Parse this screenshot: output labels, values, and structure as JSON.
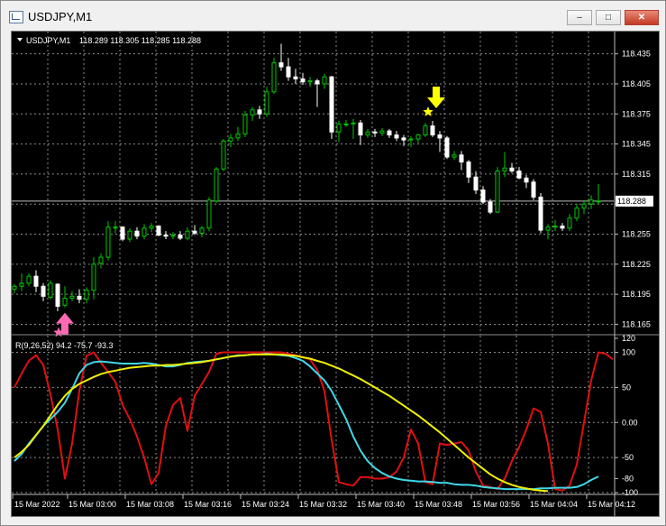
{
  "window": {
    "title": "USDJPY,M1",
    "min_glyph": "–",
    "max_glyph": "□",
    "close_glyph": "✕"
  },
  "chart_header": {
    "symbol": "USDJPY,M1",
    "ohlc": "118.289 118.305 118.285 118.288"
  },
  "price_axis": {
    "ticks": [
      "118.435",
      "118.405",
      "118.375",
      "118.345",
      "118.315",
      "118.285",
      "118.255",
      "118.225",
      "118.195",
      "118.165"
    ],
    "current_price": "118.288"
  },
  "indicator": {
    "label": "R(9,26,52) 94.2 -75.7 -93.3",
    "ticks": [
      "120",
      "100",
      "50",
      "0.00",
      "-50",
      "-80",
      "-100"
    ]
  },
  "time_axis": {
    "ticks": [
      "15 Mar 2022",
      "15 Mar 03:00",
      "15 Mar 03:08",
      "15 Mar 03:16",
      "15 Mar 03:24",
      "15 Mar 03:32",
      "15 Mar 03:40",
      "15 Mar 03:48",
      "15 Mar 03:56",
      "15 Mar 04:04",
      "15 Mar 04:12"
    ]
  },
  "colors": {
    "bull": "#00c800",
    "bear": "#ffffff",
    "grid": "#8c8c8c",
    "red": "#e01010",
    "cyan": "#40d8e8",
    "yellow": "#f0f000",
    "buy_arrow": "#ff69b4",
    "sell_arrow": "#ffff00"
  },
  "chart_data": [
    {
      "type": "candlestick",
      "ylim": [
        118.16,
        118.45
      ],
      "candles": [
        [
          118.2,
          118.205,
          118.196,
          118.203
        ],
        [
          118.203,
          118.216,
          118.198,
          118.206
        ],
        [
          118.206,
          118.216,
          118.203,
          118.213
        ],
        [
          118.213,
          118.219,
          118.197,
          118.203
        ],
        [
          118.203,
          118.206,
          118.188,
          118.193
        ],
        [
          118.192,
          118.209,
          118.19,
          118.206
        ],
        [
          118.205,
          118.206,
          118.178,
          118.183
        ],
        [
          118.184,
          118.203,
          118.182,
          118.191
        ],
        [
          118.191,
          118.198,
          118.188,
          118.193
        ],
        [
          118.193,
          118.2,
          118.186,
          118.19
        ],
        [
          118.19,
          118.202,
          118.186,
          118.199
        ],
        [
          118.199,
          118.232,
          118.19,
          118.225
        ],
        [
          118.226,
          118.236,
          118.221,
          118.232
        ],
        [
          118.232,
          118.268,
          118.229,
          118.262
        ],
        [
          118.262,
          118.268,
          118.256,
          118.262
        ],
        [
          118.262,
          118.263,
          118.248,
          118.25
        ],
        [
          118.25,
          118.261,
          118.247,
          118.258
        ],
        [
          118.258,
          118.262,
          118.25,
          118.253
        ],
        [
          118.253,
          118.265,
          118.25,
          118.261
        ],
        [
          118.261,
          118.266,
          118.257,
          118.263
        ],
        [
          118.263,
          118.264,
          118.253,
          118.254
        ],
        [
          118.254,
          118.258,
          118.25,
          118.253
        ],
        [
          118.253,
          118.257,
          118.25,
          118.254
        ],
        [
          118.254,
          118.258,
          118.249,
          118.251
        ],
        [
          118.251,
          118.262,
          118.249,
          118.258
        ],
        [
          118.258,
          118.264,
          118.254,
          118.256
        ],
        [
          118.256,
          118.263,
          118.252,
          118.261
        ],
        [
          118.261,
          118.292,
          118.258,
          118.289
        ],
        [
          118.288,
          118.322,
          118.286,
          118.32
        ],
        [
          118.32,
          118.35,
          118.318,
          118.348
        ],
        [
          118.348,
          118.355,
          118.342,
          118.351
        ],
        [
          118.351,
          118.362,
          118.348,
          118.355
        ],
        [
          118.355,
          118.378,
          118.352,
          118.374
        ],
        [
          118.374,
          118.382,
          118.368,
          118.379
        ],
        [
          118.379,
          118.383,
          118.37,
          118.375
        ],
        [
          118.375,
          118.402,
          118.372,
          118.397
        ],
        [
          118.397,
          118.431,
          118.395,
          118.426
        ],
        [
          118.426,
          118.445,
          118.418,
          118.422
        ],
        [
          118.422,
          118.431,
          118.408,
          118.412
        ],
        [
          118.412,
          118.42,
          118.405,
          118.41
        ],
        [
          118.41,
          118.416,
          118.404,
          118.407
        ],
        [
          118.407,
          118.412,
          118.402,
          118.408
        ],
        [
          118.408,
          118.41,
          118.382,
          118.405
        ],
        [
          118.405,
          118.415,
          118.4,
          118.412
        ],
        [
          118.412,
          118.413,
          118.35,
          118.357
        ],
        [
          118.357,
          118.368,
          118.347,
          118.365
        ],
        [
          118.364,
          118.369,
          118.362,
          118.365
        ],
        [
          118.365,
          118.37,
          118.35,
          118.366
        ],
        [
          118.366,
          118.369,
          118.344,
          118.354
        ],
        [
          118.354,
          118.36,
          118.351,
          118.357
        ],
        [
          118.357,
          118.36,
          118.352,
          118.356
        ],
        [
          118.356,
          118.361,
          118.353,
          118.358
        ],
        [
          118.358,
          118.36,
          118.351,
          118.354
        ],
        [
          118.354,
          118.358,
          118.348,
          118.351
        ],
        [
          118.351,
          118.354,
          118.343,
          118.349
        ],
        [
          118.349,
          118.353,
          118.342,
          118.35
        ],
        [
          118.35,
          118.355,
          118.346,
          118.354
        ],
        [
          118.354,
          118.366,
          118.352,
          118.363
        ],
        [
          118.363,
          118.368,
          118.352,
          118.354
        ],
        [
          118.354,
          118.358,
          118.337,
          118.351
        ],
        [
          118.351,
          118.353,
          118.33,
          118.332
        ],
        [
          118.332,
          118.338,
          118.329,
          118.334
        ],
        [
          118.334,
          118.338,
          118.319,
          118.327
        ],
        [
          118.327,
          118.329,
          118.306,
          118.312
        ],
        [
          118.312,
          118.318,
          118.295,
          118.299
        ],
        [
          118.299,
          118.303,
          118.285,
          118.287
        ],
        [
          118.287,
          118.29,
          118.275,
          118.277
        ],
        [
          118.277,
          118.322,
          118.276,
          118.318
        ],
        [
          118.318,
          118.337,
          118.312,
          118.321
        ],
        [
          118.321,
          118.326,
          118.316,
          118.318
        ],
        [
          118.318,
          118.322,
          118.31,
          118.311
        ],
        [
          118.311,
          118.314,
          118.301,
          118.307
        ],
        [
          118.307,
          118.31,
          118.289,
          118.292
        ],
        [
          118.292,
          118.296,
          118.256,
          118.259
        ],
        [
          118.259,
          118.265,
          118.25,
          118.262
        ],
        [
          118.262,
          118.269,
          118.258,
          118.263
        ],
        [
          118.263,
          118.266,
          118.258,
          118.261
        ],
        [
          118.261,
          118.275,
          118.258,
          118.271
        ],
        [
          118.271,
          118.285,
          118.268,
          118.281
        ],
        [
          118.281,
          118.289,
          118.275,
          118.285
        ],
        [
          118.285,
          118.294,
          118.28,
          118.289
        ],
        [
          118.288,
          118.305,
          118.285,
          118.288
        ]
      ],
      "signals": [
        {
          "kind": "buy",
          "candle": 7
        },
        {
          "kind": "sell",
          "candle": 58
        }
      ]
    },
    {
      "type": "line",
      "ylim": [
        -100,
        120
      ],
      "series": [
        {
          "color": "#e01010",
          "values": [
            50,
            70,
            88,
            96,
            82,
            40,
            -10,
            -80,
            -30,
            45,
            95,
            100,
            85,
            72,
            58,
            25,
            5,
            -20,
            -50,
            -88,
            -72,
            -5,
            25,
            35,
            -12,
            38,
            55,
            72,
            98,
            100,
            100,
            100,
            100,
            100,
            100,
            100,
            100,
            100,
            98,
            96,
            93,
            90,
            75,
            45,
            -25,
            -85,
            -88,
            -90,
            -78,
            -78,
            -80,
            -80,
            -78,
            -70,
            -50,
            -10,
            -30,
            -85,
            -88,
            -30,
            -32,
            -30,
            -28,
            -40,
            -70,
            -90,
            -92,
            -95,
            -80,
            -55,
            -35,
            -10,
            20,
            15,
            -30,
            -95,
            -97,
            -90,
            -60,
            0,
            60,
            100,
            98,
            90
          ]
        },
        {
          "color": "#40d8e8",
          "values": [
            -55,
            -45,
            -30,
            -18,
            -5,
            5,
            15,
            28,
            48,
            70,
            82,
            86,
            87,
            86,
            85,
            84,
            84,
            84,
            85,
            84,
            82,
            80,
            80,
            82,
            85,
            86,
            87,
            88,
            90,
            92,
            94,
            96,
            96,
            97,
            97,
            98,
            97,
            96,
            95,
            92,
            88,
            80,
            70,
            60,
            45,
            25,
            5,
            -20,
            -40,
            -55,
            -65,
            -72,
            -77,
            -80,
            -82,
            -83,
            -84,
            -84,
            -85,
            -86,
            -86,
            -88,
            -89,
            -89,
            -90,
            -92,
            -93,
            -94,
            -95,
            -95,
            -95,
            -95,
            -95,
            -94,
            -94,
            -93,
            -93,
            -93,
            -92,
            -88,
            -82,
            -77
          ]
        },
        {
          "color": "#f0f000",
          "values": [
            -50,
            -42,
            -32,
            -18,
            -5,
            10,
            25,
            38,
            48,
            55,
            60,
            65,
            69,
            72,
            74,
            76,
            78,
            79,
            80,
            81,
            81,
            82,
            82,
            83,
            84,
            85,
            86,
            88,
            90,
            92,
            94,
            95,
            96,
            97,
            97,
            97,
            97,
            97,
            96,
            95,
            93,
            91,
            88,
            85,
            81,
            77,
            72,
            67,
            62,
            56,
            50,
            44,
            38,
            31,
            24,
            17,
            10,
            2,
            -6,
            -14,
            -23,
            -32,
            -41,
            -50,
            -58,
            -66,
            -74,
            -80,
            -85,
            -89,
            -92,
            -94,
            -96,
            -97,
            -98
          ]
        }
      ]
    }
  ]
}
